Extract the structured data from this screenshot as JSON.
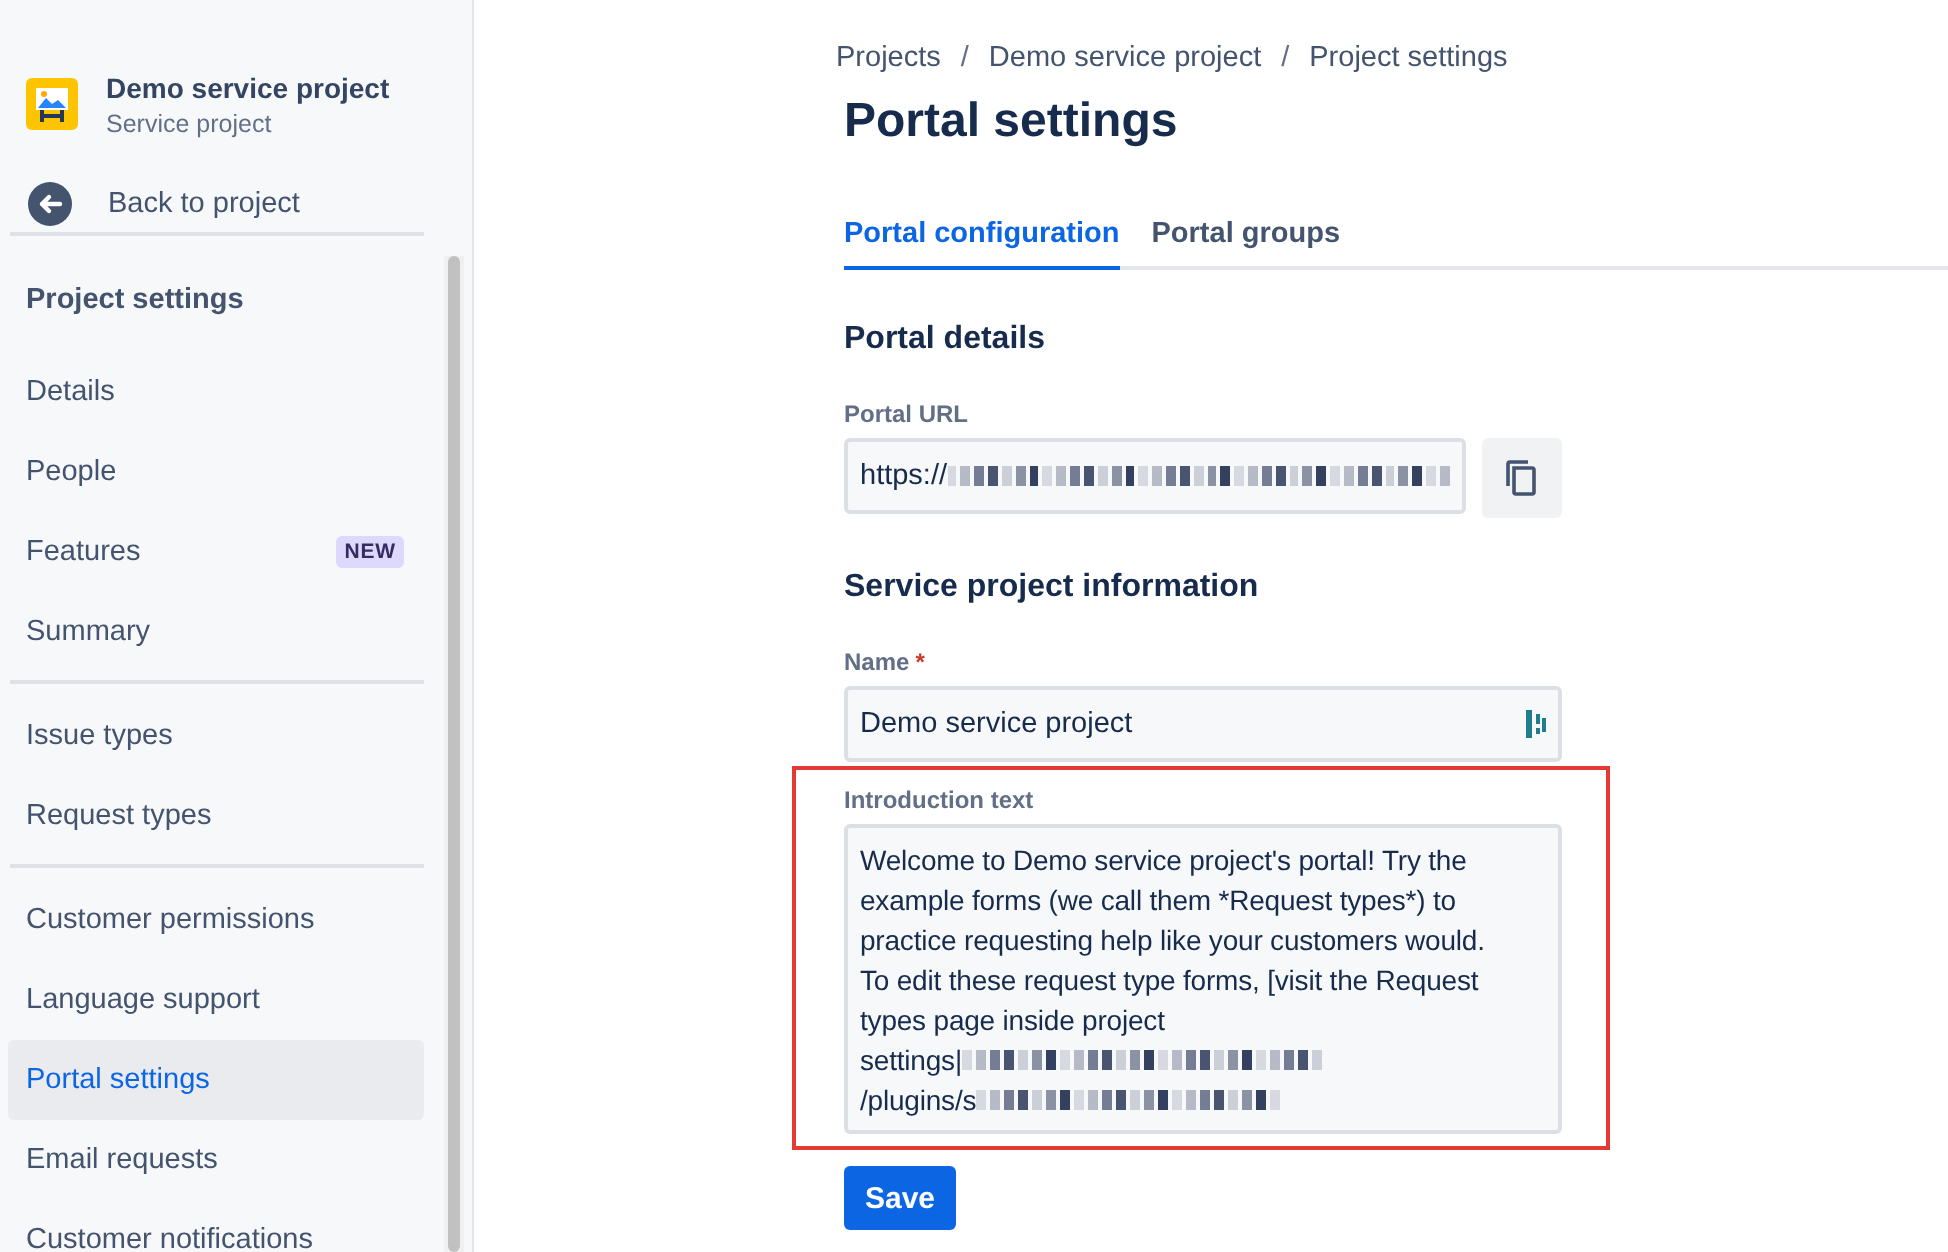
{
  "sidebar": {
    "project": {
      "name": "Demo service project",
      "type": "Service project"
    },
    "back_link": "Back to project",
    "heading": "Project settings",
    "groups": [
      {
        "items": [
          {
            "label": "Details",
            "selected": false
          },
          {
            "label": "People",
            "selected": false
          },
          {
            "label": "Features",
            "selected": false,
            "badge": "NEW"
          },
          {
            "label": "Summary",
            "selected": false
          }
        ]
      },
      {
        "items": [
          {
            "label": "Issue types",
            "selected": false
          },
          {
            "label": "Request types",
            "selected": false
          }
        ]
      },
      {
        "items": [
          {
            "label": "Customer permissions",
            "selected": false
          },
          {
            "label": "Language support",
            "selected": false
          },
          {
            "label": "Portal settings",
            "selected": true
          },
          {
            "label": "Email requests",
            "selected": false
          },
          {
            "label": "Customer notifications",
            "selected": false
          }
        ]
      }
    ]
  },
  "breadcrumbs": [
    {
      "label": "Projects"
    },
    {
      "separator": "/",
      "label": "Demo service project"
    },
    {
      "separator": "/",
      "label": "Project settings"
    }
  ],
  "title": "Portal settings",
  "tabs": [
    {
      "label": "Portal configuration",
      "selected": true
    },
    {
      "label": "Portal groups",
      "selected": false
    }
  ],
  "portal_details": {
    "heading": "Portal details",
    "url_label": "Portal URL",
    "url_value": "https://"
  },
  "project_info": {
    "heading": "Service project information",
    "name_label": "Name",
    "name_required_mark": "*",
    "name_value": "Demo service project",
    "intro_label": "Introduction text",
    "intro_lines": [
      {
        "text": "Welcome to Demo service project's portal! Try the",
        "redacted": false
      },
      {
        "text": "example forms (we call them *Request types*) to",
        "redacted": false
      },
      {
        "text": "practice requesting help like your customers would.",
        "redacted": false
      },
      {
        "text": "To edit these request type forms, [visit the Request",
        "redacted": false
      },
      {
        "text": "types page inside project",
        "redacted": false
      },
      {
        "text": "settings|",
        "redacted": true
      },
      {
        "text": "/plugins/s",
        "redacted": true
      }
    ],
    "highlighted": true
  },
  "save_button": "Save"
}
